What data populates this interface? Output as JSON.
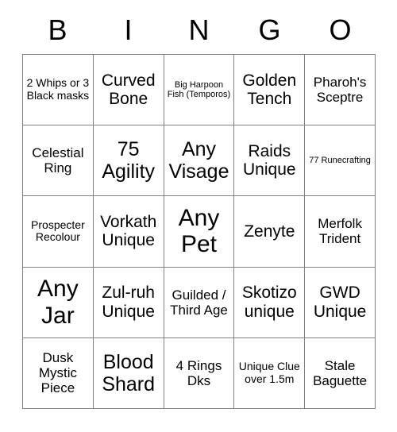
{
  "card": {
    "header_letters": [
      "B",
      "I",
      "N",
      "G",
      "O"
    ],
    "columns": 5,
    "rows": 5,
    "background_color": "#ffffff",
    "border_color": "#808080",
    "text_color": "#000000",
    "cells": [
      {
        "text": "2 Whips or 3 Black masks",
        "size": "sm"
      },
      {
        "text": "Curved Bone",
        "size": "lg"
      },
      {
        "text": "Big Harpoon Fish (Temporos)",
        "size": "xs"
      },
      {
        "text": "Golden Tench",
        "size": "lg"
      },
      {
        "text": "Pharoh's Sceptre",
        "size": "md"
      },
      {
        "text": "Celestial Ring",
        "size": "md"
      },
      {
        "text": "75 Agility",
        "size": "xl"
      },
      {
        "text": "Any Visage",
        "size": "xl"
      },
      {
        "text": "Raids Unique",
        "size": "lg"
      },
      {
        "text": "77 Runecrafting",
        "size": "xs"
      },
      {
        "text": "Prospecter Recolour",
        "size": "sm"
      },
      {
        "text": "Vorkath Unique",
        "size": "lg"
      },
      {
        "text": "Any Pet",
        "size": "xxl"
      },
      {
        "text": "Zenyte",
        "size": "lg"
      },
      {
        "text": "Merfolk Trident",
        "size": "md"
      },
      {
        "text": "Any Jar",
        "size": "xxl"
      },
      {
        "text": "Zul-ruh Unique",
        "size": "lg"
      },
      {
        "text": "Guilded / Third Age",
        "size": "md"
      },
      {
        "text": "Skotizo unique",
        "size": "lg"
      },
      {
        "text": "GWD Unique",
        "size": "lg"
      },
      {
        "text": "Dusk Mystic Piece",
        "size": "md"
      },
      {
        "text": "Blood Shard",
        "size": "xl"
      },
      {
        "text": "4 Rings Dks",
        "size": "md"
      },
      {
        "text": "Unique Clue over 1.5m",
        "size": "sm"
      },
      {
        "text": "Stale Baguette",
        "size": "md"
      }
    ]
  }
}
